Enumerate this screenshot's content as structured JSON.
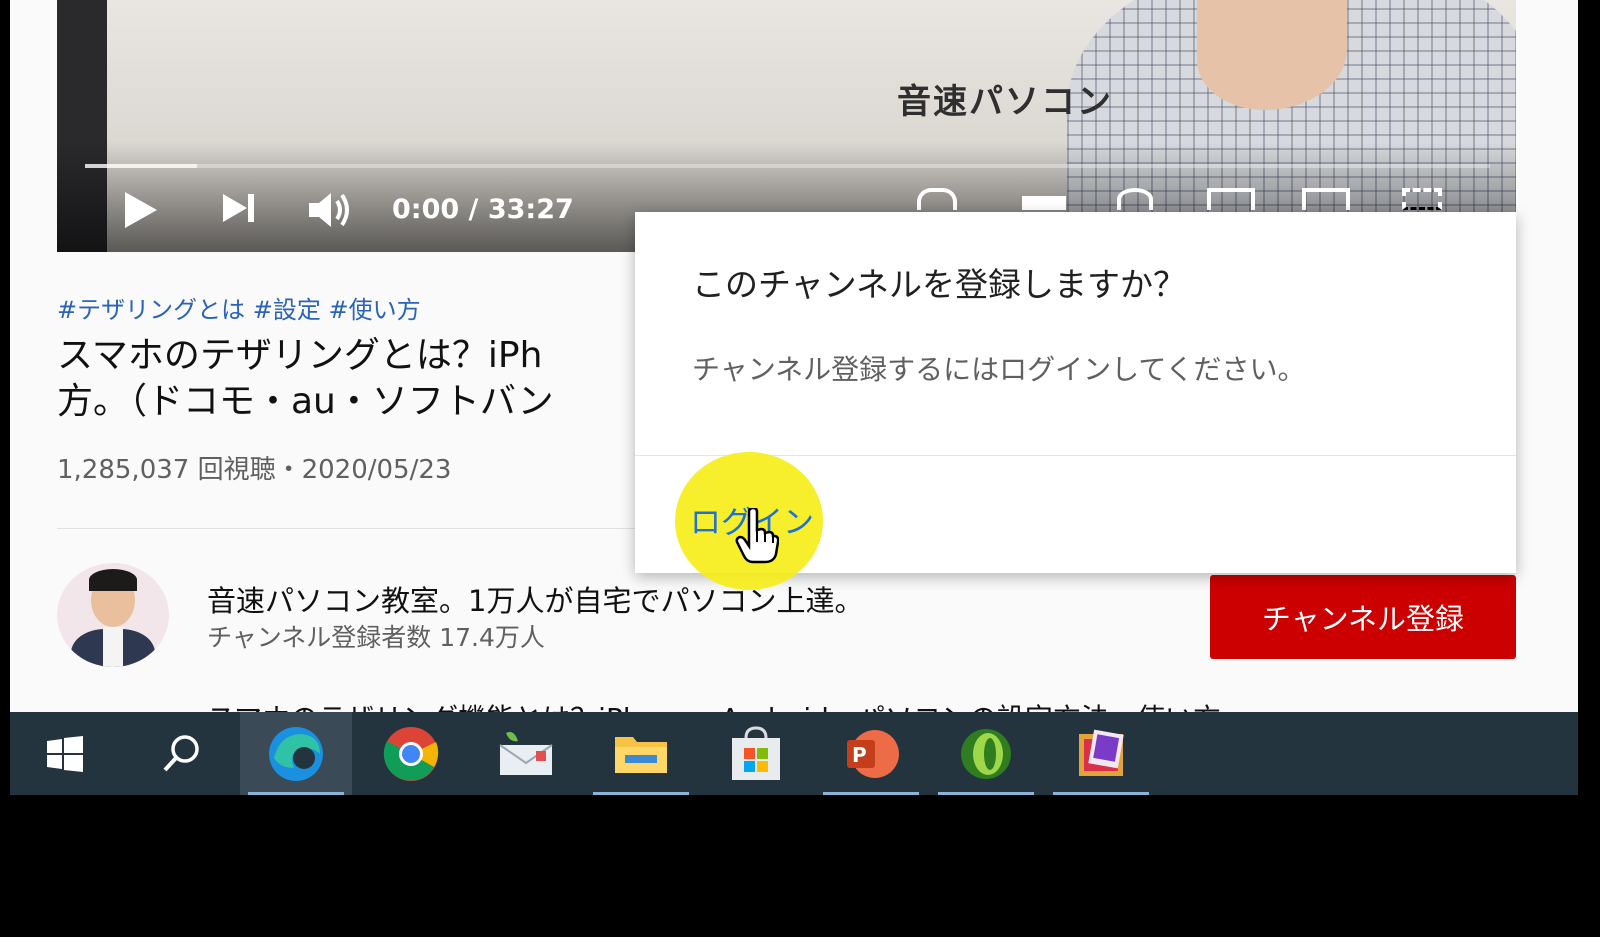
{
  "player": {
    "overlay_text": "音速パソコン",
    "time": "0:00 / 33:27",
    "progress_fraction": 0.0,
    "buffered_fraction": 0.08
  },
  "video": {
    "hashtags": "#テザリングとは #設定 #使い方",
    "title_line1": "スマホのテザリングとは？iPh",
    "title_line2": "方。（ドコモ・au・ソフトバン",
    "stats": "1,285,037 回視聴・2020/05/23"
  },
  "channel": {
    "name": "音速パソコン教室。1万人が自宅でパソコン上達。",
    "subscribers": "チャンネル登録者数 17.4万人",
    "subscribe_label": "チャンネル登録"
  },
  "description_peek": "スマホのテザリング機能とは？iPhone・Android・パソコンの設定方法、使い方",
  "dialog": {
    "title": "このチャンネルを登録しますか？",
    "message": "チャンネル登録するにはログインしてください。",
    "login_label": "ログイン"
  },
  "taskbar": {
    "items": [
      "windows-start-icon",
      "search-icon",
      "edge-icon",
      "chrome-icon",
      "mail-icon",
      "file-explorer-icon",
      "store-icon",
      "powerpoint-icon",
      "green-app-icon",
      "photo-app-icon"
    ],
    "accent": "#8ab4d8"
  },
  "colors": {
    "subscribe_red": "#cc0000",
    "link_blue": "#1e73d2",
    "highlight_yellow": "#f6ee1a",
    "taskbar_bg": "#24343f"
  }
}
